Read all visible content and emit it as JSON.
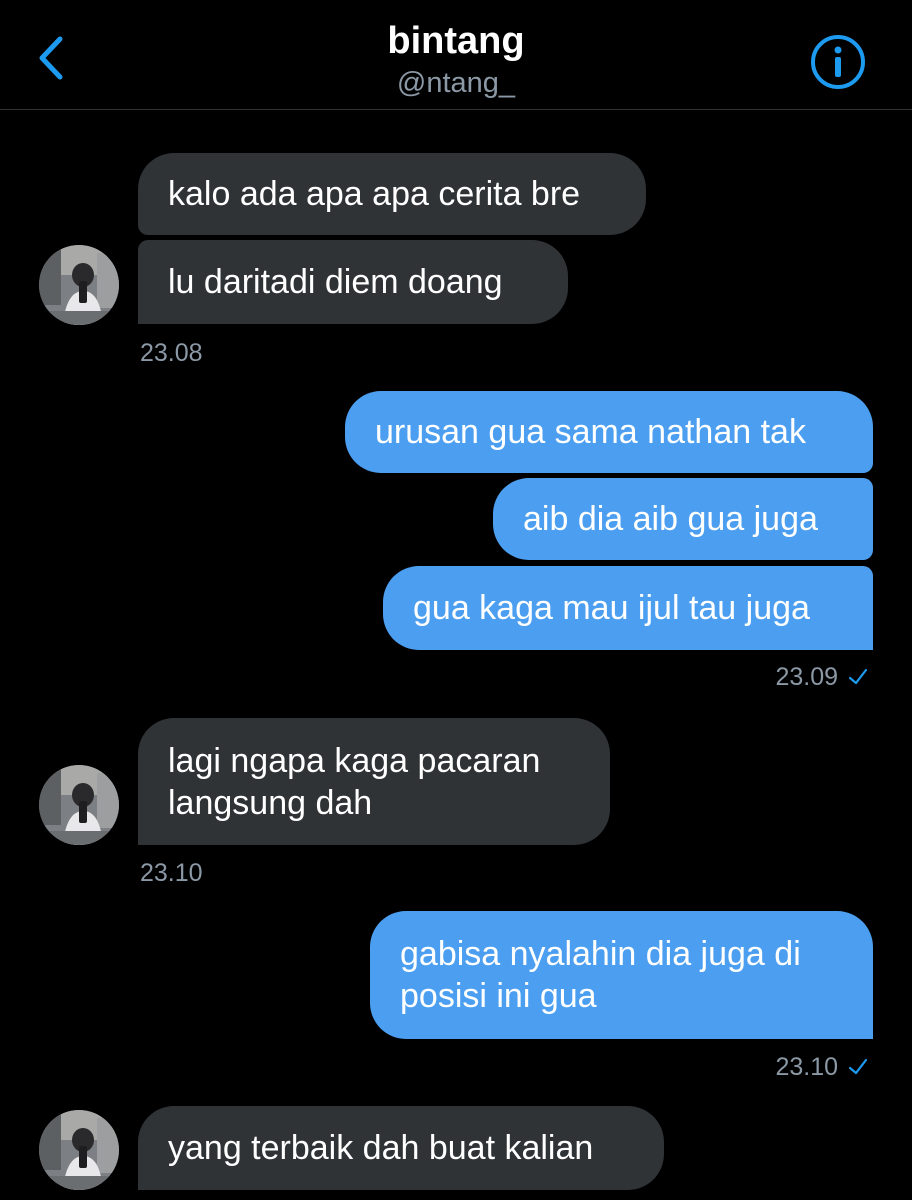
{
  "header": {
    "title": "bintang",
    "handle": "@ntang_"
  },
  "colors": {
    "background": "#000000",
    "accent": "#1d9bf0",
    "sent_bubble": "#4c9ff0",
    "received_bubble": "#2f3336",
    "timestamp": "#8b98a5"
  },
  "icons": {
    "back": "chevron-left-icon",
    "info": "info-circle-icon",
    "read": "checkmark-icon"
  },
  "messages": [
    {
      "from": "them",
      "text": "kalo ada apa apa cerita bre"
    },
    {
      "from": "them",
      "text": "lu daritadi diem doang"
    },
    {
      "from": "them",
      "time": "23.08"
    },
    {
      "from": "me",
      "text": "urusan gua sama nathan tak"
    },
    {
      "from": "me",
      "text": "aib dia aib gua juga"
    },
    {
      "from": "me",
      "text": "gua kaga mau ijul tau juga"
    },
    {
      "from": "me",
      "time": "23.09"
    },
    {
      "from": "them",
      "text_lines": [
        "lagi ngapa kaga pacaran",
        "langsung dah"
      ]
    },
    {
      "from": "them",
      "time": "23.10"
    },
    {
      "from": "me",
      "text_lines": [
        "gabisa nyalahin dia juga di",
        "posisi ini gua"
      ]
    },
    {
      "from": "me",
      "time": "23.10"
    },
    {
      "from": "them",
      "text": "yang terbaik dah buat kalian"
    }
  ]
}
